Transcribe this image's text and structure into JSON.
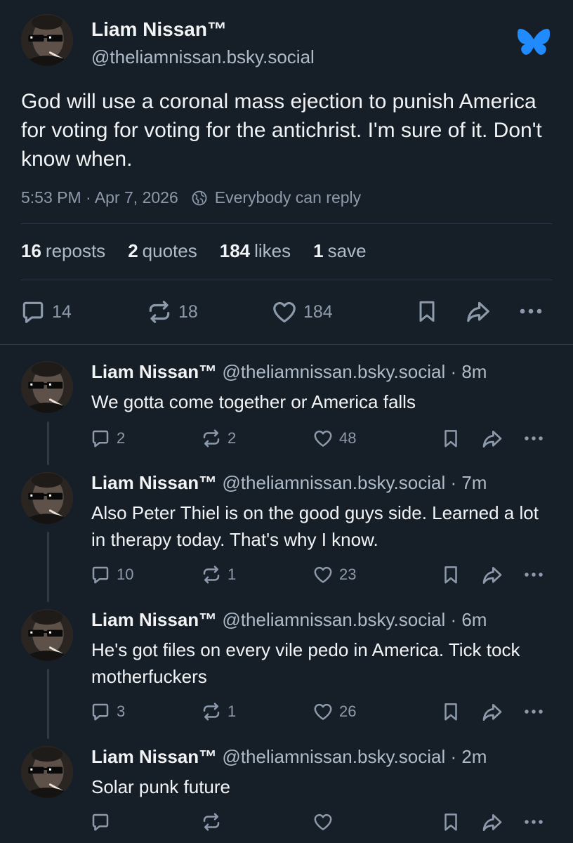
{
  "post": {
    "author_name": "Liam Nissan™",
    "author_handle": "@theliamnissan.bsky.social",
    "text": "God will use a coronal mass ejection to punish America for voting for voting for the antichrist. I'm sure of it. Don't know when.",
    "timestamp": "5:53 PM · Apr 7, 2026",
    "reply_setting": "Everybody can reply",
    "stats": {
      "reposts_count": "16",
      "reposts_label": "reposts",
      "quotes_count": "2",
      "quotes_label": "quotes",
      "likes_count": "184",
      "likes_label": "likes",
      "saves_count": "1",
      "saves_label": "save"
    },
    "actions": {
      "replies": "14",
      "reposts": "18",
      "likes": "184"
    }
  },
  "replies": [
    {
      "name": "Liam Nissan™",
      "handle": "@theliamnissan.bsky.social",
      "time": " · 8m",
      "text": "We gotta come together or America falls",
      "replies": "2",
      "reposts": "2",
      "likes": "48"
    },
    {
      "name": "Liam Nissan™",
      "handle": "@theliamnissan.bsky.social",
      "time": " · 7m",
      "text": "Also Peter Thiel is on the good guys side. Learned a lot in therapy today. That's why I know.",
      "replies": "10",
      "reposts": "1",
      "likes": "23"
    },
    {
      "name": "Liam Nissan™",
      "handle": "@theliamnissan.bsky.social",
      "time": " · 6m",
      "text": "He's got files on every vile pedo in America. Tick tock motherfuckers",
      "replies": "3",
      "reposts": "1",
      "likes": "26"
    },
    {
      "name": "Liam Nissan™",
      "handle": "@theliamnissan.bsky.social",
      "time": " · 2m",
      "text": "Solar punk future",
      "replies": "",
      "reposts": "",
      "likes": ""
    }
  ],
  "icons": {
    "app_logo": "butterfly-icon",
    "reply": "speech-bubble-icon",
    "repost": "repost-arrows-icon",
    "like": "heart-icon",
    "bookmark": "bookmark-icon",
    "share": "share-arrow-icon",
    "more": "ellipsis-icon",
    "reply_setting": "globe-icon"
  },
  "colors": {
    "background": "#161e27",
    "text": "#f1f3f5",
    "secondary": "#aebbc9",
    "muted": "#8c9aab",
    "brand": "#208bfe",
    "divider": "#2e3a47"
  }
}
